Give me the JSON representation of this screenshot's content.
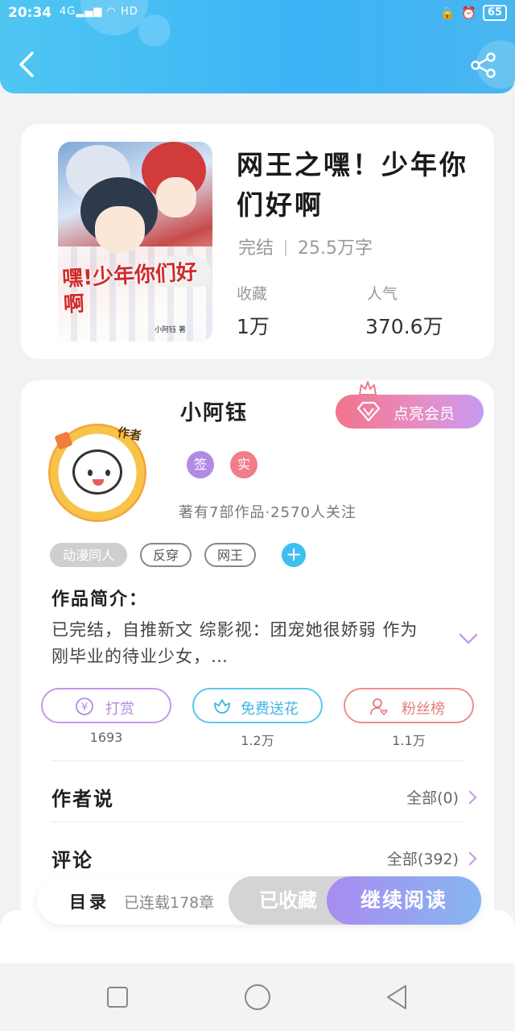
{
  "status_bar": {
    "time": "20:34",
    "signal": "4G",
    "network": "HD",
    "battery": "65"
  },
  "book": {
    "title": "网王之嘿！少年你们好啊",
    "status": "完结",
    "word_count": "25.5万字",
    "favorites_label": "收藏",
    "favorites_value": "1万",
    "popularity_label": "人气",
    "popularity_value": "370.6万",
    "cover_title": "嘿!少年你们好啊",
    "cover_author": "小阿钰 著"
  },
  "author": {
    "name": "小阿钰",
    "avatar_badge": "作者",
    "vip_button": "点亮会员",
    "badge_signed": "签",
    "badge_real": "实",
    "stats": "著有7部作品·2570人关注",
    "tags": [
      "动漫同人",
      "反穿",
      "网王"
    ],
    "intro_title": "作品简介：",
    "intro_text": "已完结，自推新文 综影视：团宠她很娇弱 作为刚毕业的待业少女，…"
  },
  "actions": {
    "reward_label": "打赏",
    "reward_count": "1693",
    "flower_label": "免费送花",
    "flower_count": "1.2万",
    "fans_label": "粉丝榜",
    "fans_count": "1.1万"
  },
  "sections": {
    "author_says": "作者说",
    "author_says_link": "全部(0)",
    "comments": "评论",
    "comments_link": "全部(392)"
  },
  "read_bar": {
    "toc": "目录",
    "serial": "已连载178章",
    "collected": "已收藏",
    "continue": "继续阅读"
  },
  "colors": {
    "header_blue": "#3cb3f5",
    "accent_purple": "#c39ae8",
    "reward_border": "#c39ae8",
    "flower_border": "#5ac8ec",
    "fans_border": "#ef8d8d"
  }
}
